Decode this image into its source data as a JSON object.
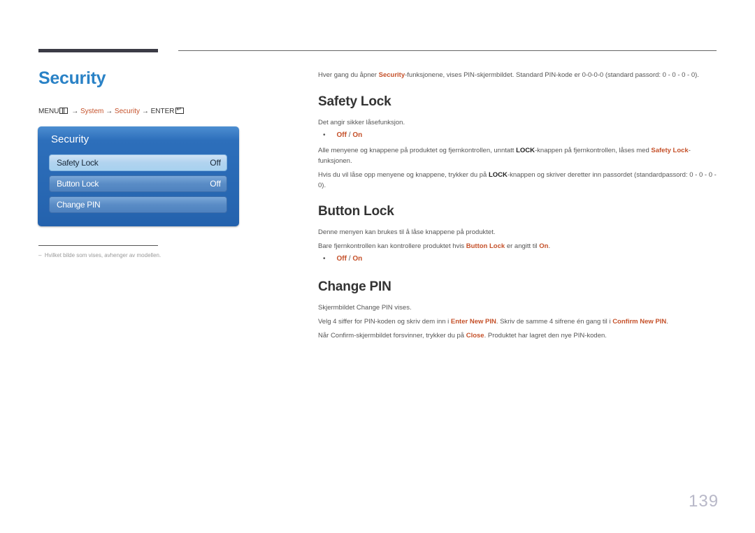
{
  "page": {
    "title": "Security",
    "page_number": "139"
  },
  "menu_path": {
    "menu": "MENU",
    "menu_icon": "menu-grid-icon",
    "arrow": "→",
    "system": "System",
    "security": "Security",
    "enter": "ENTER",
    "enter_icon": "enter-icon"
  },
  "osd": {
    "title": "Security",
    "items": [
      {
        "label": "Safety Lock",
        "value": "Off",
        "selected": true
      },
      {
        "label": "Button Lock",
        "value": "Off",
        "selected": false
      },
      {
        "label": "Change PIN",
        "value": "",
        "selected": false
      }
    ]
  },
  "footnote": "Hvilket bilde som vises, avhenger av modellen.",
  "footnote_dash": "–",
  "intro": {
    "pre": "Hver gang du åpner ",
    "hl": "Security",
    "post": "-funksjonene, vises PIN-skjermbildet. Standard PIN-kode er 0-0-0-0 (standard passord: 0 - 0 - 0 - 0)."
  },
  "sections": {
    "safety_lock": {
      "heading": "Safety Lock",
      "desc": "Det angir sikker låsefunksjon.",
      "opt_off": "Off",
      "opt_sep": " / ",
      "opt_on": "On",
      "p1_pre": "Alle menyene og knappene på produktet og fjernkontrollen, unntatt ",
      "p1_bold": "LOCK",
      "p1_mid": "-knappen på fjernkontrollen, låses med ",
      "p1_hl": "Safety Lock",
      "p1_post": "-funksjonen.",
      "p2_pre": "Hvis du vil låse opp menyene og knappene, trykker du på ",
      "p2_bold": "LOCK",
      "p2_post": "-knappen og skriver deretter inn passordet (standardpassord: 0 - 0 - 0 - 0)."
    },
    "button_lock": {
      "heading": "Button Lock",
      "desc": "Denne menyen kan brukes til å låse knappene på produktet.",
      "p1_pre": "Bare fjernkontrollen kan kontrollere produktet hvis ",
      "p1_hl": "Button Lock",
      "p1_mid": " er angitt til ",
      "p1_hl2": "On",
      "p1_post": ".",
      "opt_off": "Off",
      "opt_sep": " / ",
      "opt_on": "On"
    },
    "change_pin": {
      "heading": "Change PIN",
      "desc": "Skjermbildet Change PIN vises.",
      "p1_pre": "Velg 4 siffer for PIN-koden og skriv dem inn i ",
      "p1_hl": "Enter New PIN",
      "p1_mid": ". Skriv de samme 4 sifrene én gang til i ",
      "p1_hl2": "Confirm New PIN",
      "p1_post": ".",
      "p2_pre": "Når Confirm-skjermbildet forsvinner, trykker du på ",
      "p2_hl": "Close",
      "p2_post": ". Produktet har lagret den nye PIN-koden."
    }
  },
  "colors": {
    "title_blue": "#2a82c6",
    "highlight_orange": "#c5512a",
    "osd_blue": "#2462ad"
  }
}
